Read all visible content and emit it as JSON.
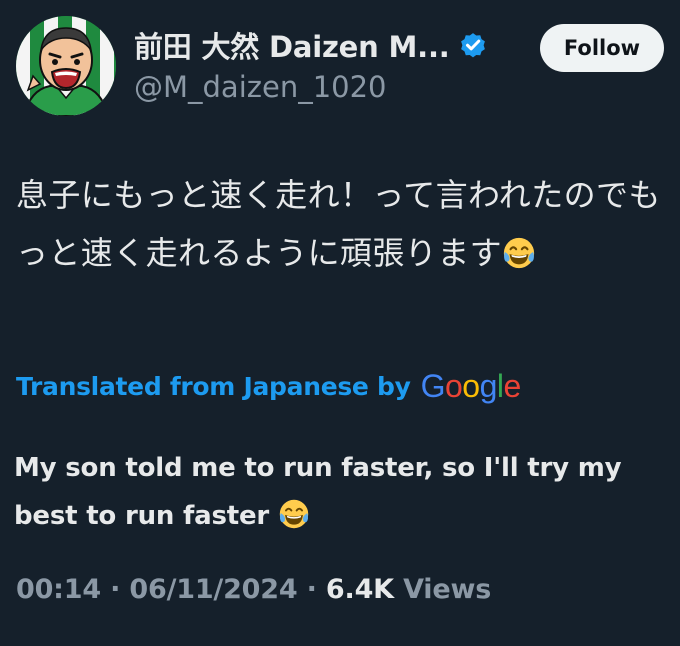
{
  "author": {
    "display_name": "前田 大然 Daizen M...",
    "handle": "@M_daizen_1020",
    "avatar_icon": "cartoon-avatar-icon",
    "verified_icon": "verified-badge-icon"
  },
  "follow_button": {
    "label": "Follow"
  },
  "tweet": {
    "text": "息子にもっと速く走れ！って言われたのでもっと速く走れるように頑張ります",
    "emoji": "face-with-tears-of-joy-icon"
  },
  "translation": {
    "label": "Translated from Japanese by",
    "provider_letters": [
      "G",
      "o",
      "o",
      "g",
      "l",
      "e"
    ],
    "text": "My son told me to run faster, so I'll try my best to run faster",
    "emoji": "face-with-tears-of-joy-icon"
  },
  "meta": {
    "time": "00:14",
    "separator": "·",
    "date": "06/11/2024",
    "views_count": "6.4K",
    "views_label": "Views"
  },
  "colors": {
    "background": "#15202b",
    "accent": "#1d9bf0",
    "muted": "#8b98a5",
    "text": "#e7e9ea"
  }
}
